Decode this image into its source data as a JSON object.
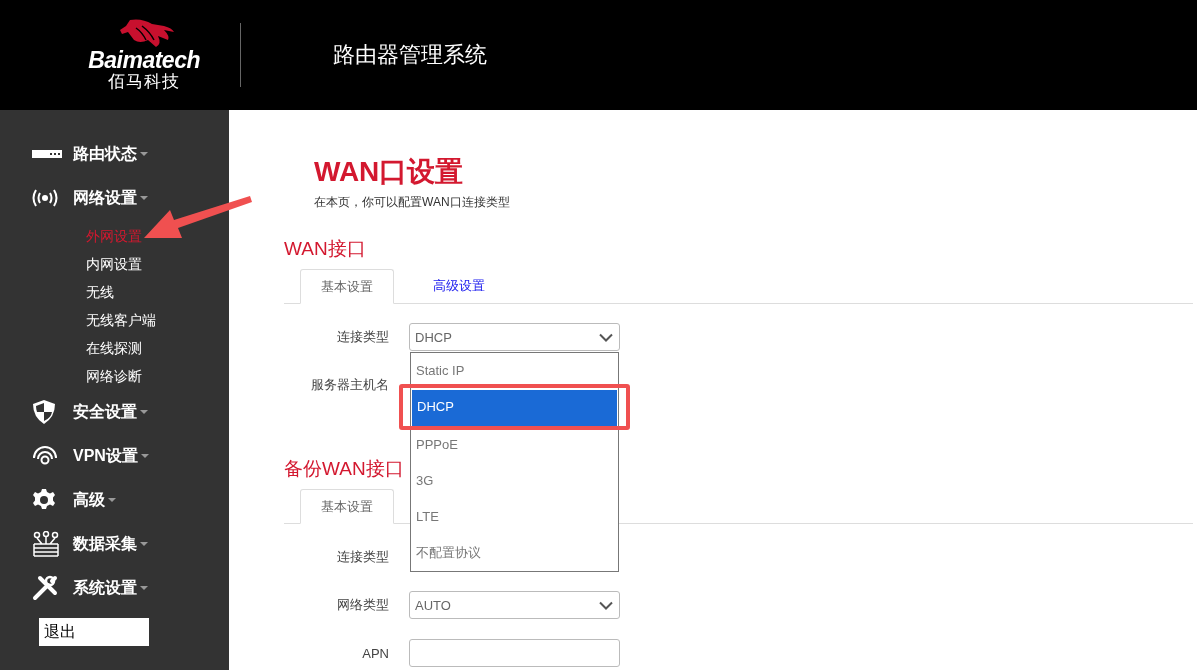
{
  "header": {
    "logo_text": "Baimatech",
    "logo_subtext": "佰马科技",
    "title": "路由器管理系统"
  },
  "sidebar": {
    "items": [
      {
        "label": "路由状态"
      },
      {
        "label": "网络设置",
        "children": [
          {
            "label": "外网设置",
            "selected": true
          },
          {
            "label": "内网设置",
            "selected": false
          },
          {
            "label": "无线",
            "selected": false
          },
          {
            "label": "无线客户端",
            "selected": false
          },
          {
            "label": "在线探测",
            "selected": false
          },
          {
            "label": "网络诊断",
            "selected": false
          }
        ]
      },
      {
        "label": "安全设置"
      },
      {
        "label": "VPN设置"
      },
      {
        "label": "高级"
      },
      {
        "label": "数据采集"
      },
      {
        "label": "系统设置"
      }
    ],
    "logout": "退出"
  },
  "page": {
    "title": "WAN口设置",
    "subtitle": "在本页，你可以配置WAN口连接类型"
  },
  "sections": [
    {
      "title": "WAN接口",
      "tabs": [
        {
          "label": "基本设置",
          "selected": true
        },
        {
          "label": "高级设置",
          "selected": false
        }
      ],
      "rows": [
        {
          "label": "连接类型",
          "kind": "select",
          "value": "DHCP",
          "options": [
            {
              "label": "Static IP",
              "selected": false
            },
            {
              "label": "DHCP",
              "selected": true
            },
            {
              "label": "PPPoE",
              "selected": false
            },
            {
              "label": "3G",
              "selected": false
            },
            {
              "label": "LTE",
              "selected": false
            },
            {
              "label": "不配置协议",
              "selected": false
            }
          ]
        },
        {
          "label": "服务器主机名",
          "kind": "covered"
        }
      ]
    },
    {
      "title": "备份WAN接口",
      "tabs": [
        {
          "label": "基本设置",
          "selected": true
        }
      ],
      "rows": [
        {
          "label": "连接类型",
          "kind": "covered"
        },
        {
          "label": "网络类型",
          "kind": "select",
          "value": "AUTO"
        },
        {
          "label": "APN",
          "kind": "input"
        }
      ]
    }
  ]
}
